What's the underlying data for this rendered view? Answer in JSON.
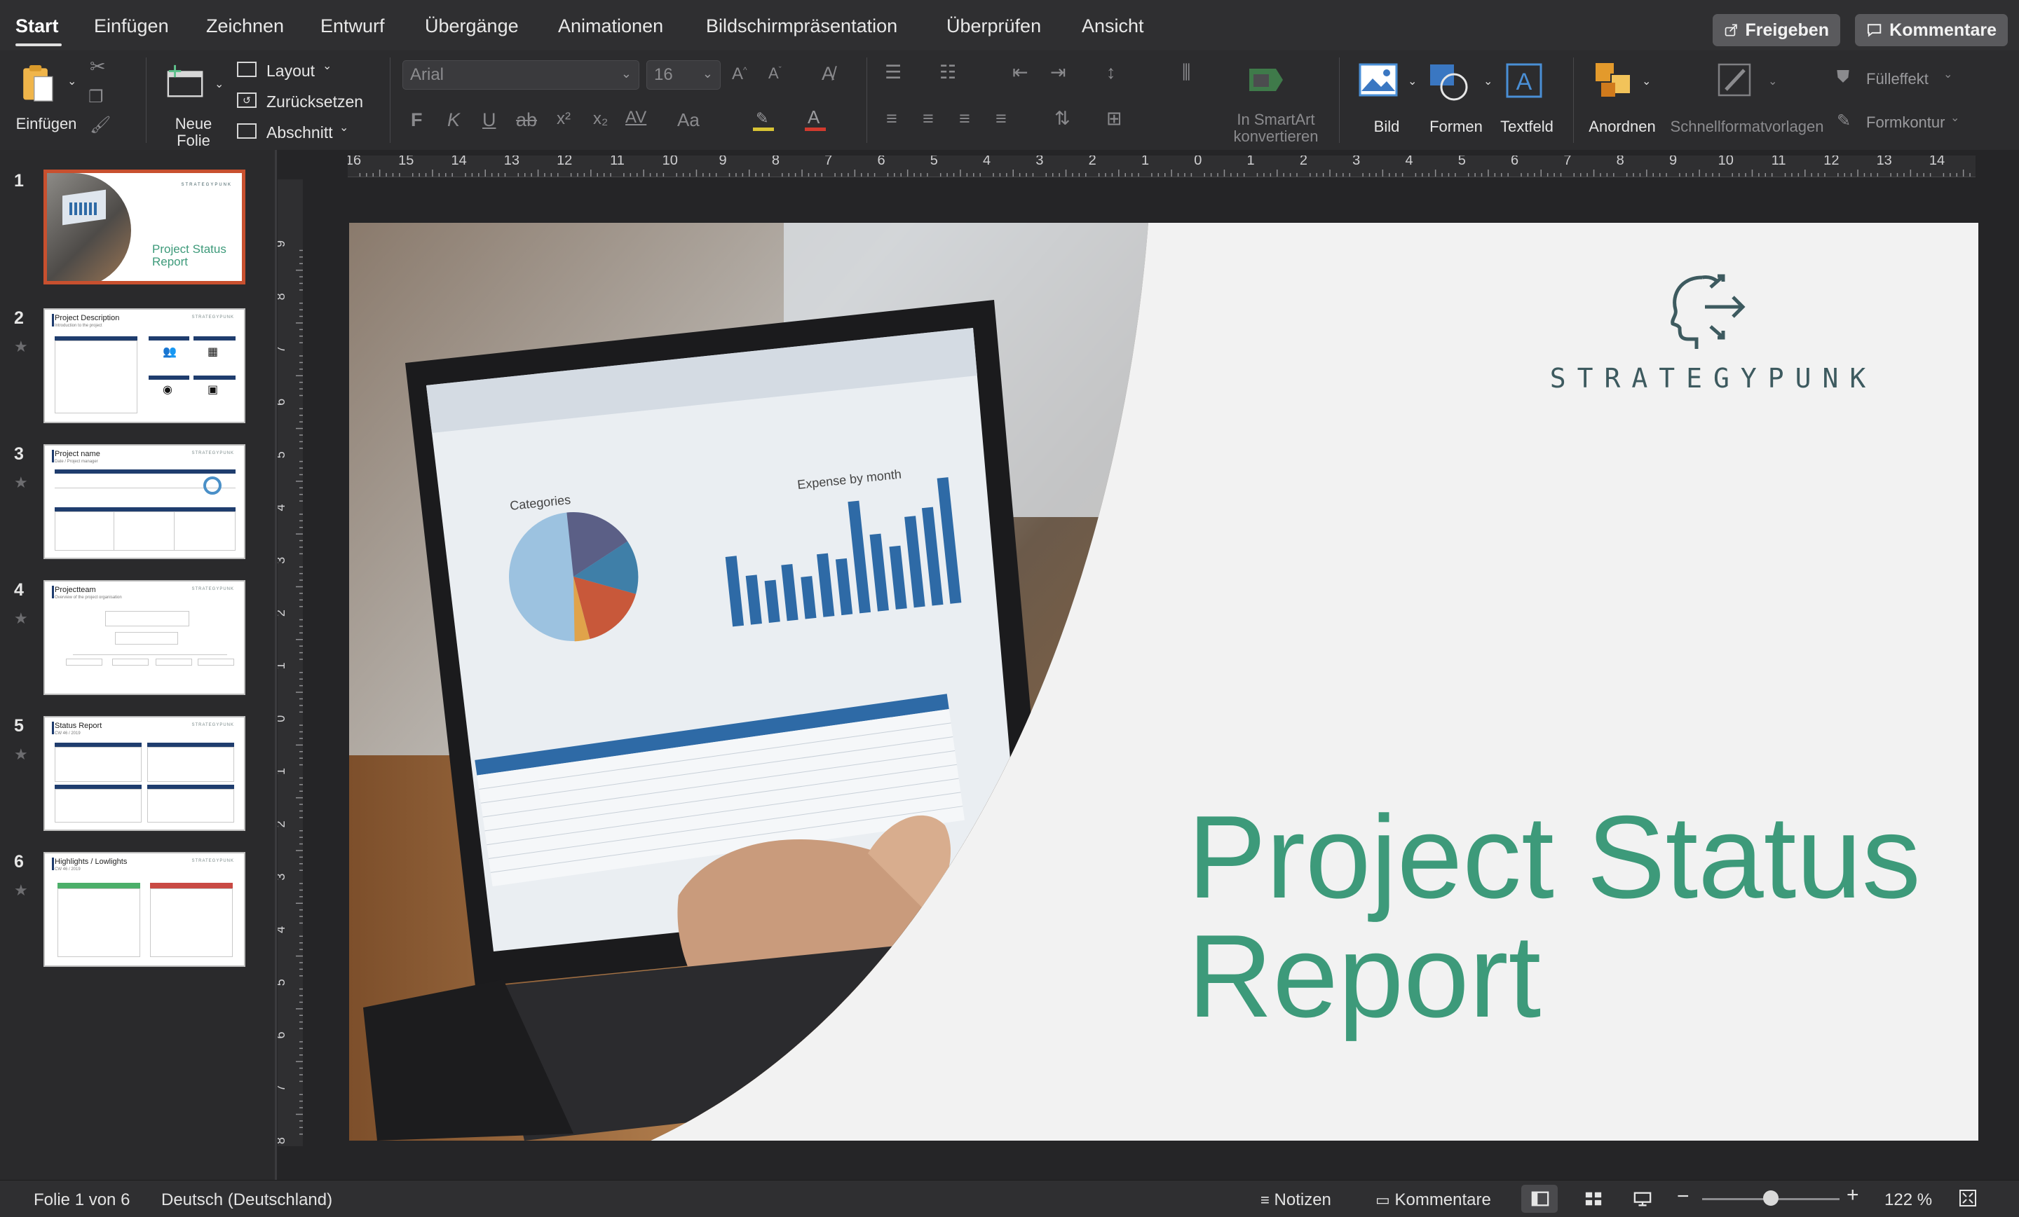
{
  "tabs": [
    {
      "label": "Start",
      "active": true
    },
    {
      "label": "Einfügen"
    },
    {
      "label": "Zeichnen"
    },
    {
      "label": "Entwurf"
    },
    {
      "label": "Übergänge"
    },
    {
      "label": "Animationen"
    },
    {
      "label": "Bildschirmpräsentation"
    },
    {
      "label": "Überprüfen"
    },
    {
      "label": "Ansicht"
    }
  ],
  "header_buttons": {
    "share": "Freigeben",
    "comments": "Kommentare"
  },
  "ribbon": {
    "paste": "Einfügen",
    "new_slide_line1": "Neue",
    "new_slide_line2": "Folie",
    "layout": "Layout",
    "reset": "Zurücksetzen",
    "section": "Abschnitt",
    "font_name": "Arial",
    "font_size": "16",
    "bold": "F",
    "italic": "K",
    "underline": "U",
    "strike": "ab",
    "superscript": "x²",
    "subscript": "x₂",
    "char_spacing": "AV",
    "change_case": "Aa",
    "smartart_line1": "In SmartArt",
    "smartart_line2": "konvertieren",
    "picture": "Bild",
    "shapes": "Formen",
    "textbox": "Textfeld",
    "arrange": "Anordnen",
    "quick_styles": "Schnellformatvorlagen",
    "fill": "Fülleffekt",
    "outline": "Formkontur"
  },
  "ruler": {
    "h_ticks": [
      "16",
      "15",
      "14",
      "13",
      "12",
      "11",
      "10",
      "9",
      "8",
      "7",
      "6",
      "5",
      "4",
      "3",
      "2",
      "1",
      "0",
      "1",
      "2",
      "3",
      "4",
      "5",
      "6",
      "7",
      "8",
      "9",
      "10",
      "11",
      "12",
      "13",
      "14",
      "15",
      "16"
    ],
    "v_ticks": [
      "9",
      "8",
      "7",
      "6",
      "5",
      "4",
      "3",
      "2",
      "1",
      "0",
      "1",
      "2",
      "3",
      "4",
      "5",
      "6",
      "7",
      "8",
      "9"
    ]
  },
  "slides": [
    {
      "number": "1",
      "title": "Project Status Report",
      "selected": true
    },
    {
      "number": "2",
      "title": "Project Description",
      "subtitle": "Introduction to the project"
    },
    {
      "number": "3",
      "title": "Project name",
      "subtitle": "Date / Project manager"
    },
    {
      "number": "4",
      "title": "Projectteam",
      "subtitle": "Overview of the project organisation"
    },
    {
      "number": "5",
      "title": "Status Report",
      "subtitle": "CW 46 / 2019"
    },
    {
      "number": "6",
      "title": "Highlights / Lowlights",
      "subtitle": "CW 46 / 2019"
    }
  ],
  "slide": {
    "brand": "STRATEGYPUNK",
    "title_line1": "Project Status",
    "title_line2": "Report",
    "title_color": "#3d9a7a",
    "screen_chart_title": "Expense by month",
    "screen_pie_title": "Categories"
  },
  "statusbar": {
    "slide_info": "Folie 1 von 6",
    "language": "Deutsch (Deutschland)",
    "notes": "Notizen",
    "comments": "Kommentare",
    "zoom": "122 %",
    "zoom_fraction": 0.5
  }
}
